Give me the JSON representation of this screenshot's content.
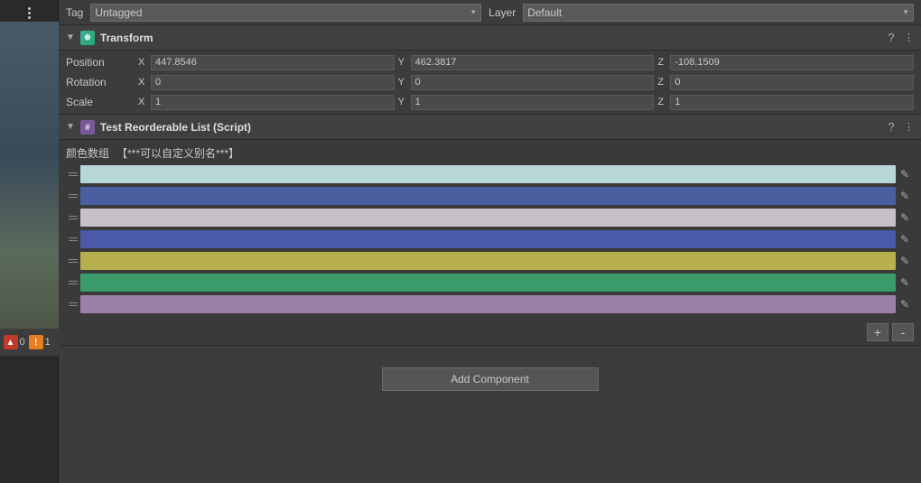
{
  "tagLayer": {
    "tagLabel": "Tag",
    "tagValue": "Untagged",
    "layerLabel": "Layer",
    "layerValue": "Default"
  },
  "transform": {
    "title": "Transform",
    "position": {
      "label": "Position",
      "x": {
        "axis": "X",
        "value": "447.8546"
      },
      "y": {
        "axis": "Y",
        "value": "462.3817"
      },
      "z": {
        "axis": "Z",
        "value": "-108.1509"
      }
    },
    "rotation": {
      "label": "Rotation",
      "x": {
        "axis": "X",
        "value": "0"
      },
      "y": {
        "axis": "Y",
        "value": "0"
      },
      "z": {
        "axis": "Z",
        "value": "0"
      }
    },
    "scale": {
      "label": "Scale",
      "x": {
        "axis": "X",
        "value": "1"
      },
      "y": {
        "axis": "Y",
        "value": "1"
      },
      "z": {
        "axis": "Z",
        "value": "1"
      }
    }
  },
  "script": {
    "title": "Test Reorderable List (Script)",
    "colorListLabel": "颜色数组",
    "colorListSubtitle": "【***可以自定义别名***】",
    "colors": [
      {
        "hex": "#b8d8d8"
      },
      {
        "hex": "#4a5fa0"
      },
      {
        "hex": "#c8c0c8"
      },
      {
        "hex": "#4a5aa8"
      },
      {
        "hex": "#b8b050"
      },
      {
        "hex": "#3a9a6a"
      },
      {
        "hex": "#9a80a8"
      }
    ]
  },
  "addComponent": {
    "label": "Add Component"
  },
  "bottomBar": {
    "errorCount": "0",
    "warnCount": "1"
  },
  "icons": {
    "drag": "≡",
    "pencil": "✎",
    "help": "?",
    "menu": "⋮",
    "arrow": "▼",
    "plus": "+",
    "minus": "-",
    "dots": "⋮"
  }
}
